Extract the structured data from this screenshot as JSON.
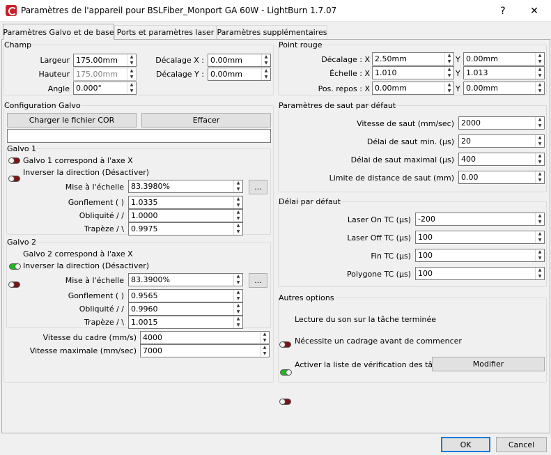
{
  "window": {
    "title": "Paramètres de l'appareil pour BSLFiber_Monport GA 60W - LightBurn 1.7.07",
    "help": "?",
    "close": "✕"
  },
  "tabs": [
    "Paramètres Galvo et de base",
    "Ports et paramètres laser",
    "Paramètres supplémentaires"
  ],
  "champ": {
    "title": "Champ",
    "largeur_label": "Largeur",
    "largeur": "175.00mm",
    "hauteur_label": "Hauteur",
    "hauteur": "175.00mm",
    "angle_label": "Angle",
    "angle": "0.000°",
    "decx_label": "Décalage X :",
    "decx": "0.00mm",
    "decy_label": "Décalage Y :",
    "decy": "0.00mm"
  },
  "point_rouge": {
    "title": "Point rouge",
    "dec_label": "Décalage : X",
    "dec_x": "2.50mm",
    "dec_y": "0.00mm",
    "ech_label": "Échelle : X",
    "ech_x": "1.010",
    "ech_y": "1.013",
    "pos_label": "Pos. repos : X",
    "pos_x": "0.00mm",
    "pos_y": "0.00mm",
    "y_label": "Y"
  },
  "galvo_config": {
    "title": "Configuration Galvo",
    "load_cor": "Charger le fichier COR",
    "clear": "Effacer",
    "cor_path": ""
  },
  "galvo1": {
    "title": "Galvo 1",
    "axis_toggle": "Galvo 1 correspond à l'axe X",
    "invert": "Inverser la direction (Désactiver)",
    "scale_label": "Mise à l'échelle",
    "scale": "83.3980%",
    "more": "...",
    "bulge_label": "Gonflement ( )",
    "bulge": "1.0335",
    "skew_label": "Obliquité / /",
    "skew": "1.0000",
    "trap_label": "Trapèze / \\",
    "trap": "0.9975"
  },
  "galvo2": {
    "title": "Galvo 2",
    "axis_toggle": "Galvo 2 correspond à l'axe X",
    "invert": "Inverser la direction (Désactiver)",
    "scale_label": "Mise à l'échelle",
    "scale": "83.3900%",
    "more": "...",
    "bulge_label": "Gonflement ( )",
    "bulge": "0.9565",
    "skew_label": "Obliquité / /",
    "skew": "0.9960",
    "trap_label": "Trapèze / \\",
    "trap": "1.0015"
  },
  "speeds": {
    "frame_label": "Vitesse du cadre (mm/s)",
    "frame": "4000",
    "max_label": "Vitesse maximale (mm/sec)",
    "max": "7000"
  },
  "jump": {
    "title": "Paramètres de saut par défaut",
    "speed_label": "Vitesse de saut (mm/sec)",
    "speed": "2000",
    "min_label": "Délai de saut min. (µs)",
    "min": "20",
    "max_label": "Délai de saut maximal (µs)",
    "max": "400",
    "limit_label": "Limite de distance de saut (mm)",
    "limit": "0.00"
  },
  "delay": {
    "title": "Délai par défaut",
    "on_label": "Laser On TC (µs)",
    "on": "-200",
    "off_label": "Laser Off TC (µs)",
    "off": "100",
    "end_label": "Fin TC (µs)",
    "end": "100",
    "poly_label": "Polygone TC (µs)",
    "poly": "100"
  },
  "other": {
    "title": "Autres options",
    "sound": "Lecture du son sur la tâche terminée",
    "frame_req": "Nécessite un cadrage avant de commencer",
    "checklist": "Activer la liste de vérification des tâches",
    "modify": "Modifier"
  },
  "footer": {
    "ok": "OK",
    "cancel": "Cancel"
  },
  "colors": {
    "toggle_on": "#1fb91f",
    "toggle_off": "#7d1414",
    "accent": "#0078d7"
  }
}
